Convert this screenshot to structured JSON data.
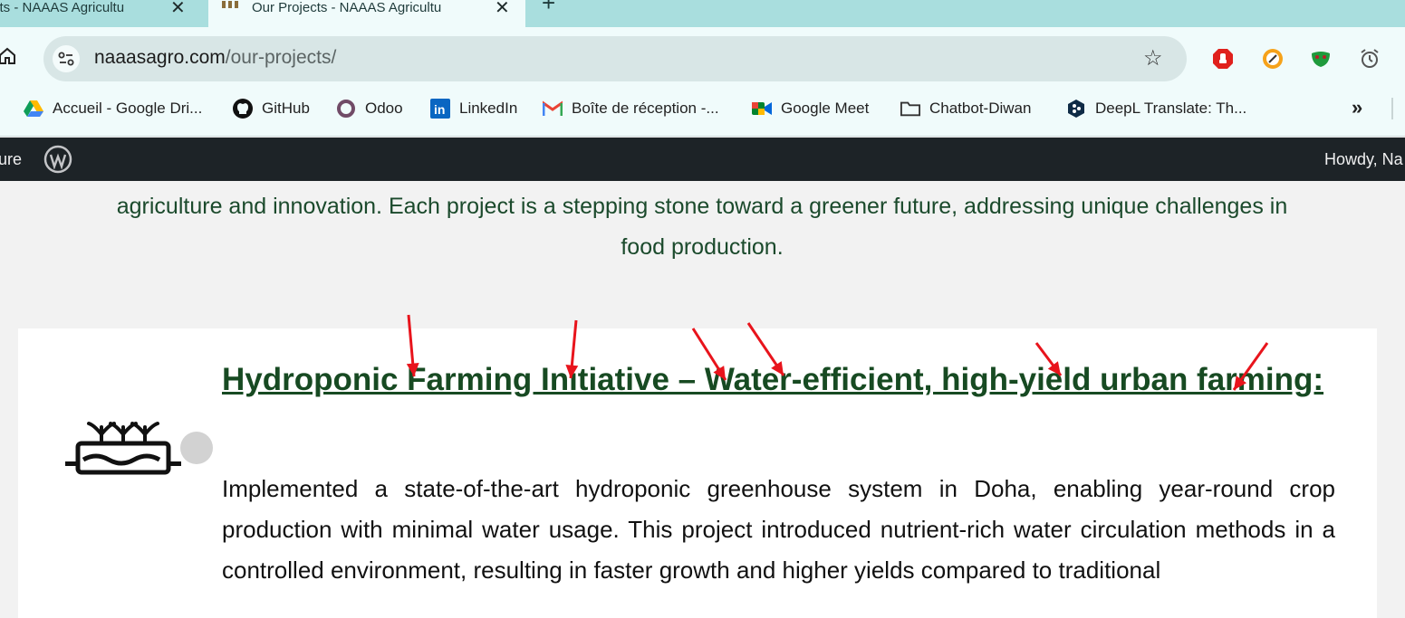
{
  "browser": {
    "tabs": [
      {
        "title": "cts - NAAAS Agricultu",
        "active": false,
        "close": "✕"
      },
      {
        "title": "Our Projects - NAAAS Agricultu",
        "active": true,
        "close": "✕"
      }
    ],
    "new_tab": "+",
    "address": {
      "domain": "naaasagro.com",
      "path": "/our-projects/"
    },
    "star": "☆",
    "extensions": [
      "adblock-icon",
      "speed-icon",
      "mask-icon",
      "alarm-icon"
    ]
  },
  "bookmarks": {
    "items": [
      {
        "label": "Accueil - Google Dri...",
        "icon": "google-drive-icon"
      },
      {
        "label": "GitHub",
        "icon": "github-icon"
      },
      {
        "label": "Odoo",
        "icon": "odoo-icon"
      },
      {
        "label": "LinkedIn",
        "icon": "linkedin-icon"
      },
      {
        "label": "Boîte de réception -...",
        "icon": "gmail-icon"
      },
      {
        "label": "Google Meet",
        "icon": "google-meet-icon"
      },
      {
        "label": "Chatbot-Diwan",
        "icon": "folder-icon"
      },
      {
        "label": "DeepL Translate: Th...",
        "icon": "deepl-icon"
      }
    ],
    "more": "»"
  },
  "adminbar": {
    "site_name": "ure",
    "howdy": "Howdy, Na"
  },
  "main": {
    "intro": "agriculture and innovation. Each project is a stepping stone toward a greener future, addressing unique challenges in food production.",
    "project": {
      "title": "Hydroponic Farming Initiative – Water-efficient, high-yield urban farming:",
      "description": "Implemented a state-of-the-art hydroponic greenhouse system in Doha, enabling year-round crop production with minimal water usage. This project introduced nutrient-rich water circulation methods in a controlled environment, resulting in faster growth and higher yields compared to traditional"
    }
  },
  "annotation_color": "#e8141c"
}
